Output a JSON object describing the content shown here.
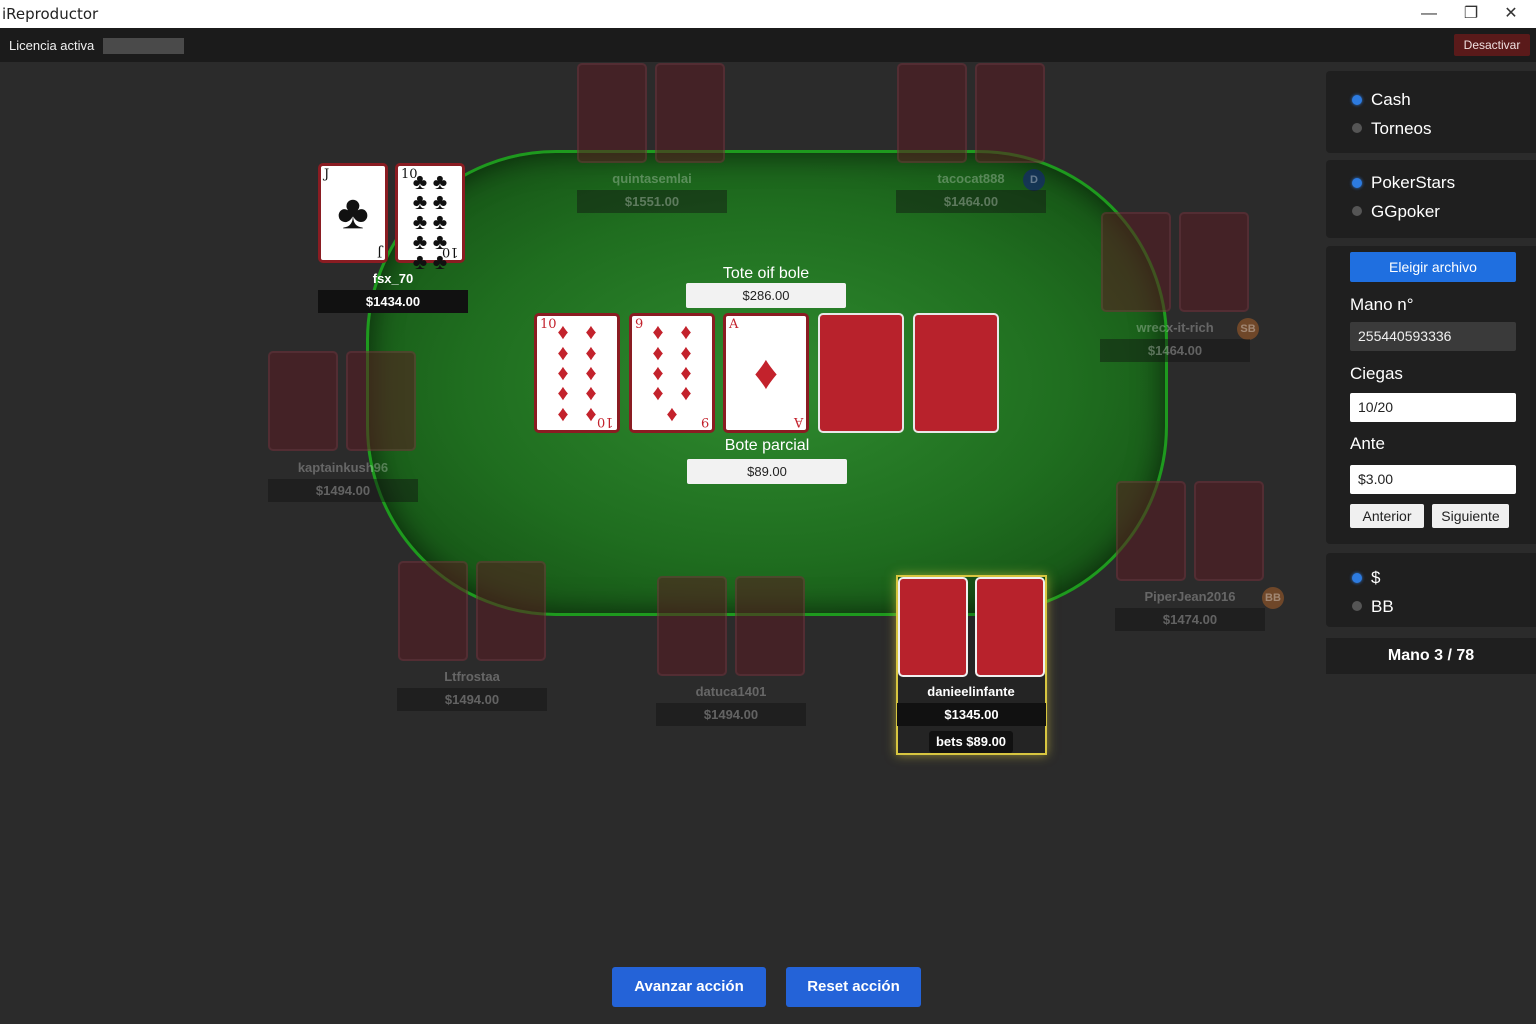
{
  "window": {
    "title": "iReproductor",
    "minimize_icon": "—",
    "maximize_icon": "❐",
    "close_icon": "✕"
  },
  "license": {
    "status": "Licencia activa",
    "deactivate_label": "Desactivar"
  },
  "board": {
    "pot_label": "Tote oif bole",
    "pot_value": "$286.00",
    "partial_label": "Bote parcial",
    "partial_value": "$89.00",
    "cards": [
      {
        "rank": "10",
        "suit": "♦",
        "color": "red"
      },
      {
        "rank": "9",
        "suit": "♦",
        "color": "red"
      },
      {
        "rank": "A",
        "suit": "♦",
        "color": "red"
      },
      {
        "rank": "",
        "suit": "",
        "color": "back"
      },
      {
        "rank": "",
        "suit": "",
        "color": "back"
      }
    ]
  },
  "players": [
    {
      "name": "fsx_70",
      "stack": "$1434.00",
      "cards": [
        {
          "rank": "J",
          "suit": "♣"
        },
        {
          "rank": "10",
          "suit": "♣"
        }
      ]
    },
    {
      "name": "quintasemlai",
      "stack": "$1551.00"
    },
    {
      "name": "tacocat888",
      "stack": "$1464.00",
      "badge": "D"
    },
    {
      "name": "wrecx-it-rich",
      "stack": "$1464.00",
      "badge": "SB"
    },
    {
      "name": "kaptainkush96",
      "stack": "$1494.00"
    },
    {
      "name": "PiperJean2016",
      "stack": "$1474.00",
      "badge": "BB"
    },
    {
      "name": "Ltfrostaa",
      "stack": "$1494.00"
    },
    {
      "name": "datuca1401",
      "stack": "$1494.00"
    },
    {
      "name": "danieelinfante",
      "stack": "$1345.00",
      "bet": "bets $89.00"
    }
  ],
  "sidebar": {
    "game_types": [
      {
        "label": "Cash",
        "selected": true
      },
      {
        "label": "Torneos",
        "selected": false
      }
    ],
    "sites": [
      {
        "label": "PokerStars",
        "selected": true
      },
      {
        "label": "GGpoker",
        "selected": false
      }
    ],
    "choose_file_label": "Eleigir archivo",
    "hand_no_label": "Mano n°",
    "hand_no_value": "255440593336",
    "blinds_label": "Ciegas",
    "blinds_value": "10/20",
    "ante_label": "Ante",
    "ante_value": "$3.00",
    "prev_label": "Anterior",
    "next_label": "Siguiente",
    "units": [
      {
        "label": "$",
        "selected": true
      },
      {
        "label": "BB",
        "selected": false
      }
    ],
    "hand_counter": "Mano 3 / 78"
  },
  "actions": {
    "advance_label": "Avanzar acción",
    "reset_label": "Reset acción"
  },
  "colors": {
    "felt": "#1f6d1f",
    "accent_blue": "#2463d8",
    "card_red": "#b8222c",
    "hero_highlight": "#d8c640"
  }
}
